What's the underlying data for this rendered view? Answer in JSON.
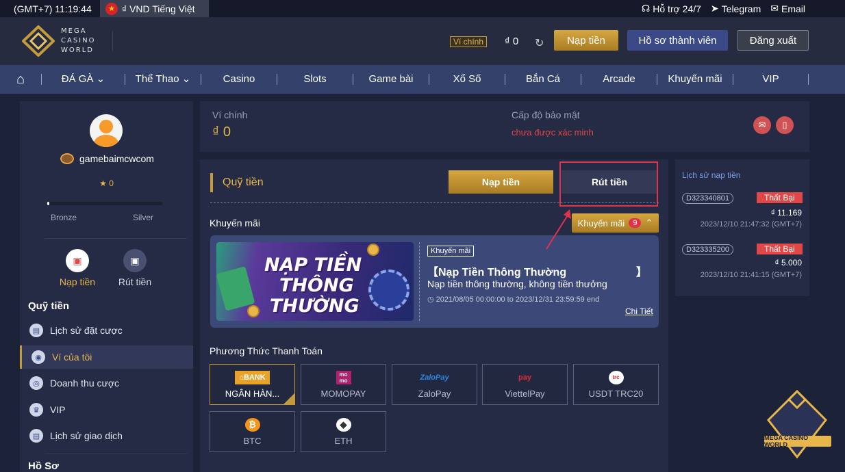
{
  "topbar": {
    "clock": "(GMT+7) 11:19:44",
    "language": "₫ VND Tiếng Việt",
    "support": "Hỗ trợ 24/7",
    "telegram": "Telegram",
    "email": "Email"
  },
  "header": {
    "brand": [
      "MEGA",
      "CASINO",
      "WORLD"
    ],
    "wallet_tag": "Ví chính",
    "wallet_balance": "₫  0",
    "deposit_button": "Nạp tiền",
    "profile_button": "Hồ sơ thành viên",
    "logout_button": "Đăng xuất"
  },
  "nav": {
    "items": [
      "ĐÁ GÀ",
      "Thể Thao",
      "Casino",
      "Slots",
      "Game bài",
      "Xổ Số",
      "Bắn Cá",
      "Arcade",
      "Khuyến mãi",
      "VIP"
    ]
  },
  "sidebar": {
    "username": "gamebaimcwcom",
    "stars": "★ 0",
    "level_progress": 0.02,
    "level_from": "Bronze",
    "level_to": "Silver",
    "quick_deposit": "Nạp tiền",
    "quick_withdraw": "Rút tiền",
    "section_title": "Quỹ tiền",
    "menu": [
      "Lịch sử đặt cược",
      "Ví của tôi",
      "Doanh thu cược",
      "VIP",
      "Lịch sử giao dịch"
    ],
    "section2_title": "Hồ Sơ"
  },
  "infobar": {
    "wallet_label": "Ví chính",
    "wallet_value": "₫ 0",
    "security_label": "Cấp độ bảo mật",
    "security_value": "chưa được xác minh"
  },
  "main": {
    "title": "Quỹ tiền",
    "tab_deposit": "Nạp tiền",
    "tab_withdraw": "Rút tiền",
    "promo_label": "Khuyến mãi",
    "promo_button": "Khuyến mãi",
    "promo_count": "9",
    "promo": {
      "image_lines": [
        "NẠP TIỀN",
        "THÔNG",
        "THƯỜNG"
      ],
      "badge": "Khuyến mãi",
      "title": "【Nạp Tiền Thông Thường",
      "title_close": "】",
      "description": "Nạp tiền thông thường, không tiền thưởng",
      "dates": "2021/08/05 00:00:00 to 2023/12/31 23:59:59 end",
      "link": "Chi Tiết"
    },
    "payment_label": "Phương Thức Thanh Toán",
    "payments": [
      {
        "label": "NGÂN HÀN...",
        "icon": "BANK"
      },
      {
        "label": "MOMOPAY",
        "icon": "mo mo"
      },
      {
        "label": "ZaloPay",
        "icon": "ZaloPay"
      },
      {
        "label": "ViettelPay",
        "icon": "pay"
      },
      {
        "label": "USDT TRC20",
        "icon": "trc"
      },
      {
        "label": "BTC",
        "icon": "₿"
      },
      {
        "label": "ETH",
        "icon": "◆"
      }
    ]
  },
  "history": {
    "title": "Lịch sử nạp tiền",
    "records": [
      {
        "code": "D323340801",
        "status": "Thất Bại",
        "amount": "₫ 11.169",
        "time": "2023/12/10 21:47:32 (GMT+7)"
      },
      {
        "code": "D323335200",
        "status": "Thất Bại",
        "amount": "₫ 5.000",
        "time": "2023/12/10 21:41:15 (GMT+7)"
      }
    ]
  },
  "watermark": "MEGA CASINO WORLD",
  "colors": {
    "accent_gold": "#c39b3c",
    "nav_blue": "#34416a",
    "panel": "#252b44",
    "alert_red": "#e04848"
  }
}
